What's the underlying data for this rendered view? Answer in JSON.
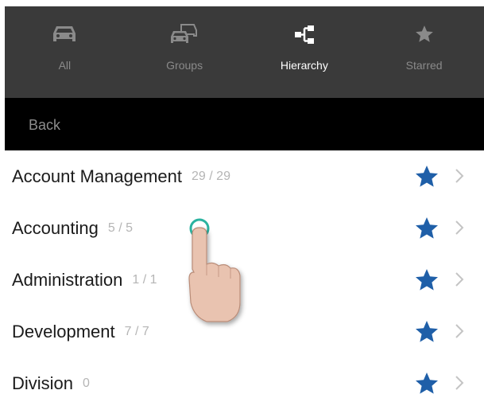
{
  "tabs": [
    {
      "label": "All",
      "icon": "car-icon",
      "active": false
    },
    {
      "label": "Groups",
      "icon": "cars-group-icon",
      "active": false
    },
    {
      "label": "Hierarchy",
      "icon": "hierarchy-icon",
      "active": true
    },
    {
      "label": "Starred",
      "icon": "star-icon",
      "active": false
    }
  ],
  "nav": {
    "back_label": "Back"
  },
  "list": [
    {
      "name": "Account Management",
      "count": "29 / 29",
      "starred": true
    },
    {
      "name": "Accounting",
      "count": "5 / 5",
      "starred": true
    },
    {
      "name": "Administration",
      "count": "1 / 1",
      "starred": true
    },
    {
      "name": "Development",
      "count": "7 / 7",
      "starred": true
    },
    {
      "name": "Division",
      "count": "0",
      "starred": true
    }
  ],
  "colors": {
    "tabbar_bg": "#3a3a3a",
    "navbar_bg": "#000000",
    "star_blue": "#1f5fa8",
    "inactive_text": "#8a8a8a",
    "touch_ring": "#2bb3a0"
  },
  "gesture": {
    "icon": "tap-hand-icon"
  }
}
